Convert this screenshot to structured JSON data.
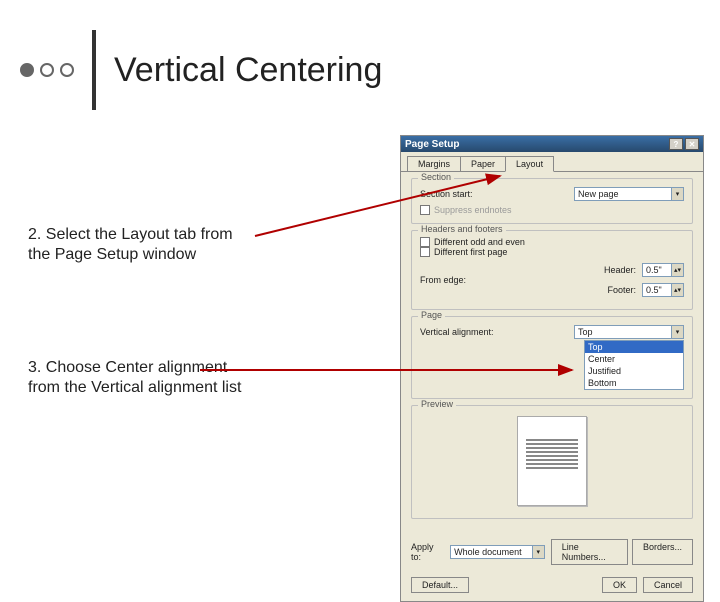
{
  "slide": {
    "title": "Vertical Centering",
    "step2": "2.  Select the Layout tab from the Page Setup window",
    "step3": "3.  Choose Center alignment from the Vertical alignment list"
  },
  "dialog": {
    "title": "Page Setup",
    "tabs": {
      "margins": "Margins",
      "paper": "Paper",
      "layout": "Layout"
    },
    "section": {
      "group": "Section",
      "start_label": "Section start:",
      "start_value": "New page",
      "suppress": "Suppress endnotes"
    },
    "hf": {
      "group": "Headers and footers",
      "odd_even": "Different odd and even",
      "first": "Different first page",
      "from_edge": "From edge:",
      "header_label": "Header:",
      "header_value": "0.5\"",
      "footer_label": "Footer:",
      "footer_value": "0.5\""
    },
    "page": {
      "group": "Page",
      "valign_label": "Vertical alignment:",
      "valign_value": "Top",
      "options": {
        "top": "Top",
        "center": "Center",
        "justified": "Justified",
        "bottom": "Bottom"
      }
    },
    "preview": {
      "group": "Preview",
      "apply_label": "Apply to:",
      "apply_value": "Whole document",
      "line_numbers": "Line Numbers...",
      "borders": "Borders..."
    },
    "buttons": {
      "default": "Default...",
      "ok": "OK",
      "cancel": "Cancel"
    }
  }
}
